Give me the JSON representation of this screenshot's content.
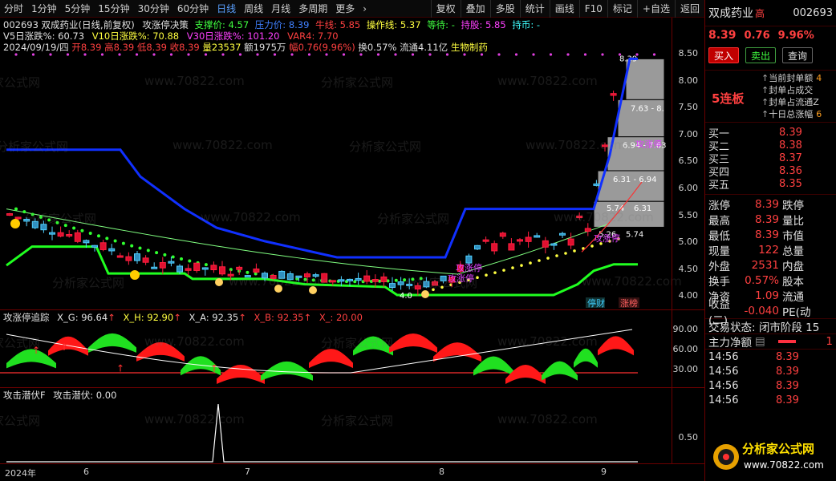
{
  "toolbar": {
    "periods": [
      "分时",
      "1分钟",
      "5分钟",
      "15分钟",
      "30分钟",
      "60分钟",
      "日线",
      "周线",
      "月线",
      "多周期",
      "更多"
    ],
    "active_period": "日线",
    "more_arrow": "›",
    "actions": [
      "复权",
      "叠加",
      "多股",
      "统计",
      "画线",
      "F10",
      "标记",
      "+自选",
      "返回"
    ]
  },
  "main_info": {
    "code_name": "002693 双成药业(日线,前复权)",
    "indicator_name": "攻涨停决策",
    "support_label": "支撑价: 4.57",
    "pressure_label": "压力价: 8.39",
    "cow_line_label": "牛线: 5.85",
    "op_line_label": "操作线: 5.37",
    "wait_label": "等待: -",
    "hold_label": "持股: 5.85",
    "coin_label": "持币: -",
    "v5": "V5日涨跌%: 60.73",
    "v10": "V10日涨跌%: 70.88",
    "v30": "V30日涨跌%: 101.20",
    "var4": "VAR4: 7.70",
    "date": "2024/09/19/四",
    "open": "开8.39",
    "high": "高8.39",
    "low": "低8.39",
    "close": "收8.39",
    "volume": "量23537",
    "amount": "额1975万",
    "amplitude": "幅0.76(9.96%)",
    "turnover": "换0.57%",
    "float": "流通4.11亿",
    "sector": "生物制药"
  },
  "price_axis": [
    "8.50",
    "8.00",
    "7.50",
    "7.00",
    "6.50",
    "6.00",
    "5.50",
    "5.00",
    "4.50",
    "4.00"
  ],
  "chart_annotations": {
    "box_labels": [
      "8.39",
      "7.63 - 8.",
      "6.94 - 7.63",
      "6.31 - 6.94",
      "5.74",
      "6.31",
      "5.26",
      "5.74"
    ],
    "gongzhangting_1": "攻涨停",
    "gongzhangting_2": "攻涨停",
    "gongzhangting_3": "攻涨停",
    "gongzhangting_4": "攻涨停",
    "low_mark": "4.0",
    "tag_stop": "停财",
    "tag_limit": "涨榜"
  },
  "osc_info": {
    "name": "攻涨停追踪",
    "xg": "X_G: 96.64",
    "xh": "X_H: 92.90",
    "xa": "X_A: 92.35",
    "xb": "X_B: 92.35",
    "x_": "X_: 20.00",
    "axis": [
      "90.00",
      "60.00",
      "30.00"
    ]
  },
  "spike_info": {
    "name": "攻击潜伏F",
    "value": "攻击潜伏: 0.00",
    "axis": [
      "0.50"
    ]
  },
  "x_axis": [
    "2024年",
    "6",
    "7",
    "8",
    "9"
  ],
  "watermark": [
    "分析家公式网",
    "www.70822.com",
    ".com"
  ],
  "sidebar": {
    "name": "双成药业",
    "tag": "高",
    "code": "002693",
    "price": "8.39",
    "change": "0.76",
    "change_pct": "9.96%",
    "buy_btn": "买入",
    "sell_btn": "卖出",
    "query_btn": "查询",
    "limit_days": "5连板",
    "limit_items": [
      {
        "label": "当前封单额",
        "value": "4"
      },
      {
        "label": "封单占成交",
        "value": ""
      },
      {
        "label": "封单占流通Z",
        "value": ""
      },
      {
        "label": "十日总涨幅",
        "value": "6"
      }
    ],
    "bids": [
      {
        "label": "买一",
        "price": "8.39"
      },
      {
        "label": "买二",
        "price": "8.38"
      },
      {
        "label": "买三",
        "price": "8.37"
      },
      {
        "label": "买四",
        "price": "8.36"
      },
      {
        "label": "买五",
        "price": "8.35"
      }
    ],
    "quote_rows": [
      {
        "lab": "涨停",
        "val": "8.39",
        "lab2": "跌停"
      },
      {
        "lab": "最高",
        "val": "8.39",
        "lab2": "量比"
      },
      {
        "lab": "最低",
        "val": "8.39",
        "lab2": "市值"
      },
      {
        "lab": "现量",
        "val": "122",
        "lab2": "总量"
      },
      {
        "lab": "外盘",
        "val": "2531",
        "lab2": "内盘"
      },
      {
        "lab": "换手",
        "val": "0.57%",
        "lab2": "股本"
      },
      {
        "lab": "净资",
        "val": "1.09",
        "lab2": "流通"
      },
      {
        "lab": "收益(二)",
        "val": "-0.040",
        "lab2": "PE(动"
      }
    ],
    "trade_state": "交易状态: 闭市阶段 15",
    "main_flow": "主力净额",
    "main_flow_val": "1",
    "ticks": [
      {
        "time": "14:56",
        "price": "8.39"
      },
      {
        "time": "14:56",
        "price": "8.39"
      },
      {
        "time": "14:56",
        "price": "8.39"
      },
      {
        "time": "14:56",
        "price": "8.39"
      }
    ],
    "logo_text": "分析家公式网",
    "logo_url": "www.70822.com"
  }
}
